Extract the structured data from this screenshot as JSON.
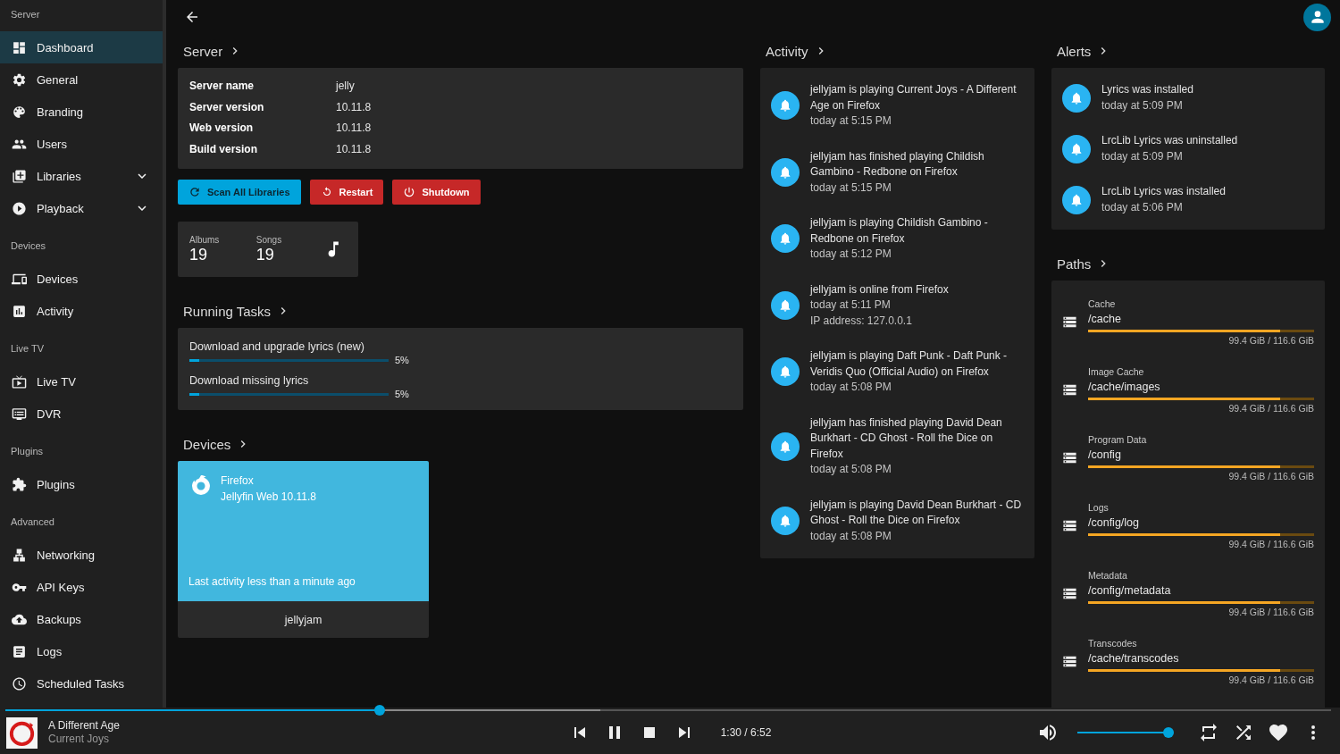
{
  "sidebar": {
    "sections": [
      {
        "heading": "Server",
        "items": [
          {
            "label": "Dashboard",
            "kind": "link",
            "selected": true
          },
          {
            "label": "General",
            "kind": "link",
            "selected": false
          },
          {
            "label": "Branding",
            "kind": "link",
            "selected": false
          },
          {
            "label": "Users",
            "kind": "link",
            "selected": false
          },
          {
            "label": "Libraries",
            "kind": "group",
            "selected": false,
            "expanded": false
          },
          {
            "label": "Playback",
            "kind": "group",
            "selected": false,
            "expanded": false
          }
        ]
      },
      {
        "heading": "Devices",
        "items": [
          {
            "label": "Devices",
            "kind": "link",
            "selected": false
          },
          {
            "label": "Activity",
            "kind": "link",
            "selected": false
          }
        ]
      },
      {
        "heading": "Live TV",
        "items": [
          {
            "label": "Live TV",
            "kind": "link",
            "selected": false
          },
          {
            "label": "DVR",
            "kind": "link",
            "selected": false
          }
        ]
      },
      {
        "heading": "Plugins",
        "items": [
          {
            "label": "Plugins",
            "kind": "link",
            "selected": false
          }
        ]
      },
      {
        "heading": "Advanced",
        "items": [
          {
            "label": "Networking",
            "kind": "link",
            "selected": false
          },
          {
            "label": "API Keys",
            "kind": "link",
            "selected": false
          },
          {
            "label": "Backups",
            "kind": "link",
            "selected": false
          },
          {
            "label": "Logs",
            "kind": "link",
            "selected": false
          },
          {
            "label": "Scheduled Tasks",
            "kind": "link",
            "selected": false
          }
        ]
      }
    ]
  },
  "server": {
    "title": "Server",
    "info": [
      {
        "label": "Server name",
        "value": "jelly"
      },
      {
        "label": "Server version",
        "value": "10.11.8"
      },
      {
        "label": "Web version",
        "value": "10.11.8"
      },
      {
        "label": "Build version",
        "value": "10.11.8"
      }
    ],
    "actions": [
      {
        "label": "Scan All Libraries",
        "kind": "primary"
      },
      {
        "label": "Restart",
        "kind": "danger"
      },
      {
        "label": "Shutdown",
        "kind": "danger"
      }
    ],
    "stats": [
      {
        "label": "Albums",
        "value": "19"
      },
      {
        "label": "Songs",
        "value": "19"
      }
    ]
  },
  "running_tasks": {
    "title": "Running Tasks",
    "tasks": [
      {
        "name": "Download and upgrade lyrics (new)",
        "level": 0.05,
        "percent": "5%"
      },
      {
        "name": "Download missing lyrics",
        "level": 0.05,
        "percent": "5%"
      }
    ]
  },
  "devices": {
    "title": "Devices",
    "cards": [
      {
        "name": "Firefox",
        "app": "Jellyfin Web 10.11.8",
        "last_activity": "Last activity less than a minute ago",
        "user": "jellyjam"
      }
    ]
  },
  "activity": {
    "title": "Activity",
    "entries": [
      {
        "text": "jellyjam is playing Current Joys - A Different Age on Firefox",
        "time": "today at 5:15 PM"
      },
      {
        "text": "jellyjam has finished playing Childish Gambino - Redbone on Firefox",
        "time": "today at 5:15 PM"
      },
      {
        "text": "jellyjam is playing Childish Gambino - Redbone on Firefox",
        "time": "today at 5:12 PM"
      },
      {
        "text": "jellyjam is online from Firefox",
        "time": "today at 5:11 PM",
        "detail": "IP address: 127.0.0.1"
      },
      {
        "text": "jellyjam is playing Daft Punk - Daft Punk - Veridis Quo (Official Audio) on Firefox",
        "time": "today at 5:08 PM"
      },
      {
        "text": "jellyjam has finished playing David Dean Burkhart - CD Ghost - Roll the Dice on Firefox",
        "time": "today at 5:08 PM"
      },
      {
        "text": "jellyjam is playing David Dean Burkhart - CD Ghost - Roll the Dice on Firefox",
        "time": "today at 5:08 PM"
      }
    ]
  },
  "alerts": {
    "title": "Alerts",
    "entries": [
      {
        "text": "Lyrics was installed",
        "time": "today at 5:09 PM"
      },
      {
        "text": "LrcLib Lyrics was uninstalled",
        "time": "today at 5:09 PM"
      },
      {
        "text": "LrcLib Lyrics was installed",
        "time": "today at 5:06 PM"
      }
    ]
  },
  "paths": {
    "title": "Paths",
    "items": [
      {
        "label": "Cache",
        "path": "/cache",
        "level": 0.85,
        "usage": "99.4 GiB / 116.6 GiB"
      },
      {
        "label": "Image Cache",
        "path": "/cache/images",
        "level": 0.85,
        "usage": "99.4 GiB / 116.6 GiB"
      },
      {
        "label": "Program Data",
        "path": "/config",
        "level": 0.85,
        "usage": "99.4 GiB / 116.6 GiB"
      },
      {
        "label": "Logs",
        "path": "/config/log",
        "level": 0.85,
        "usage": "99.4 GiB / 116.6 GiB"
      },
      {
        "label": "Metadata",
        "path": "/config/metadata",
        "level": 0.85,
        "usage": "99.4 GiB / 116.6 GiB"
      },
      {
        "label": "Transcodes",
        "path": "/cache/transcodes",
        "level": 0.85,
        "usage": "99.4 GiB / 116.6 GiB"
      }
    ]
  },
  "player": {
    "title": "A Different Age",
    "artist": "Current Joys",
    "time": "1:30 / 6:52",
    "playing": true,
    "favorite": true,
    "progress": {
      "level": 0.28
    },
    "volume": {
      "level": 0.93
    }
  }
}
